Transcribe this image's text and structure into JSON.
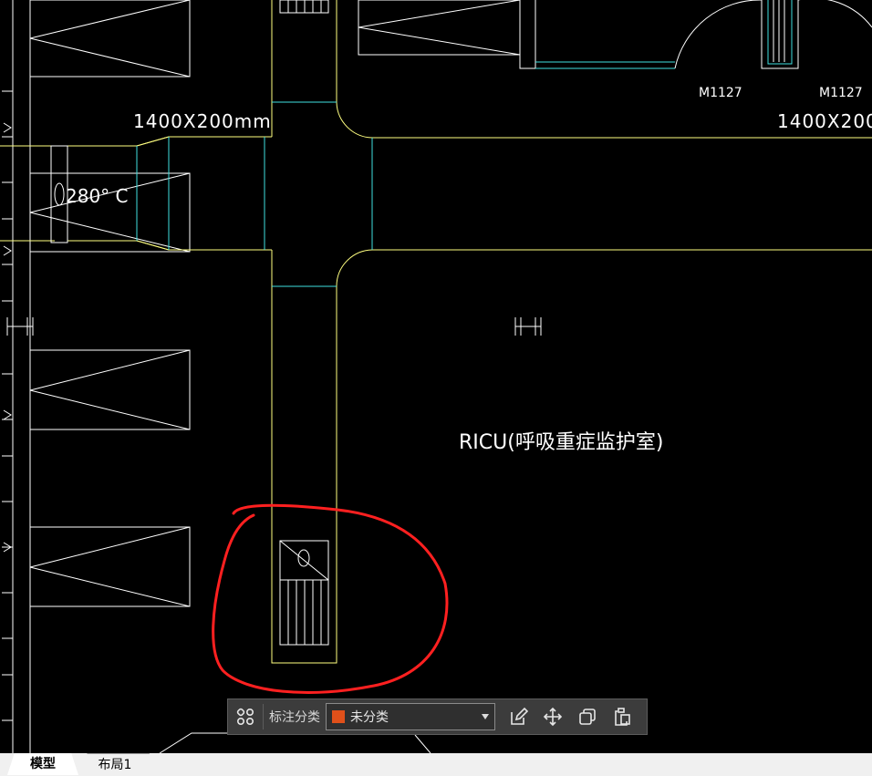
{
  "drawing": {
    "room_label": "RICU(呼吸重症监护室)",
    "duct_dim_left": "1400X200mm",
    "duct_dim_right": "1400X200",
    "door_tag_1": "M1127",
    "door_tag_2": "M1127",
    "damper_label": "280° C"
  },
  "toolbar": {
    "category_label": "标注分类",
    "category_value": "未分类",
    "category_color": "#e0501a",
    "icons": [
      "grid-icon",
      "edit-icon",
      "move-icon",
      "copy-icon",
      "paste-icon"
    ]
  },
  "tabs": {
    "model": "模型",
    "layout1": "布局1"
  },
  "colors": {
    "duct": "#ffff80",
    "wall": "#ffffff",
    "cyan": "#40e0e0",
    "annotation": "#ff2020"
  }
}
